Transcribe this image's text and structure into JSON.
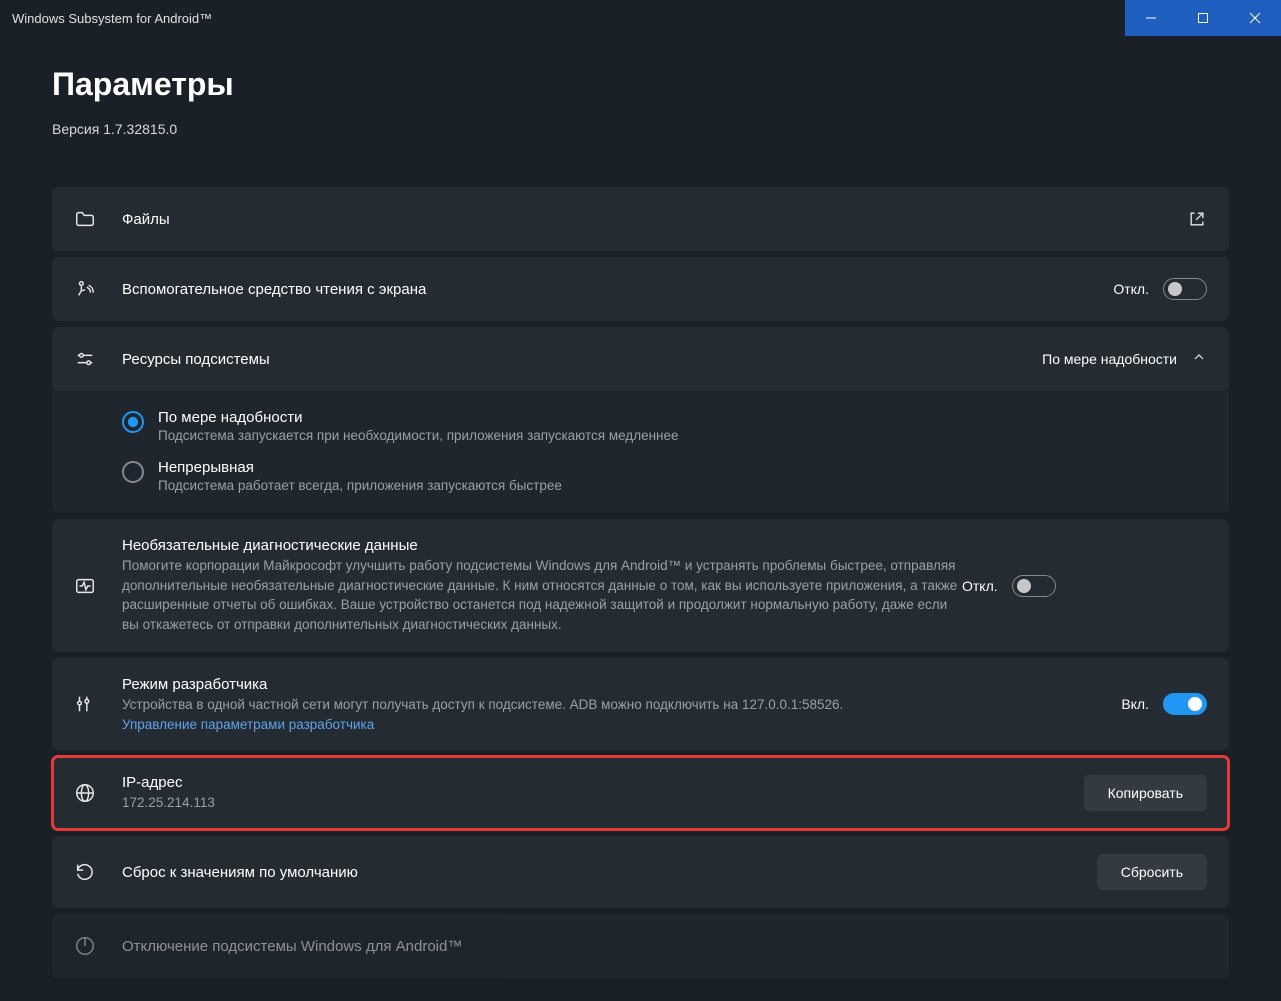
{
  "titlebar": {
    "title": "Windows Subsystem for Android™"
  },
  "header": {
    "title": "Параметры",
    "version": "Версия 1.7.32815.0"
  },
  "files": {
    "label": "Файлы"
  },
  "screenReader": {
    "label": "Вспомогательное средство чтения с экрана",
    "status": "Откл."
  },
  "resources": {
    "label": "Ресурсы подсистемы",
    "value": "По мере надобности",
    "options": {
      "0": {
        "title": "По мере надобности",
        "desc": "Подсистема запускается при необходимости, приложения запускаются медленнее"
      },
      "1": {
        "title": "Непрерывная",
        "desc": "Подсистема работает всегда, приложения запускаются быстрее"
      }
    }
  },
  "diagnostics": {
    "title": "Необязательные диагностические данные",
    "desc": "Помогите корпорации Майкрософт улучшить работу подсистемы Windows для Android™ и устранять проблемы быстрее, отправляя дополнительные необязательные диагностические данные. К ним относятся данные о том, как вы используете приложения, а также расширенные отчеты об ошибках. Ваше устройство останется под надежной защитой и продолжит нормальную работу, даже если вы откажетесь от отправки дополнительных диагностических данных.",
    "status": "Откл."
  },
  "developer": {
    "title": "Режим разработчика",
    "desc": "Устройства в одной частной сети могут получать доступ к подсистеме. ADB можно подключить на 127.0.0.1:58526.",
    "link": "Управление параметрами разработчика",
    "status": "Вкл."
  },
  "ip": {
    "title": "IP-адрес",
    "value": "172.25.214.113",
    "button": "Копировать"
  },
  "reset": {
    "title": "Сброс к значениям по умолчанию",
    "button": "Сбросить"
  },
  "shutdown": {
    "title": "Отключение подсистемы Windows для Android™"
  }
}
